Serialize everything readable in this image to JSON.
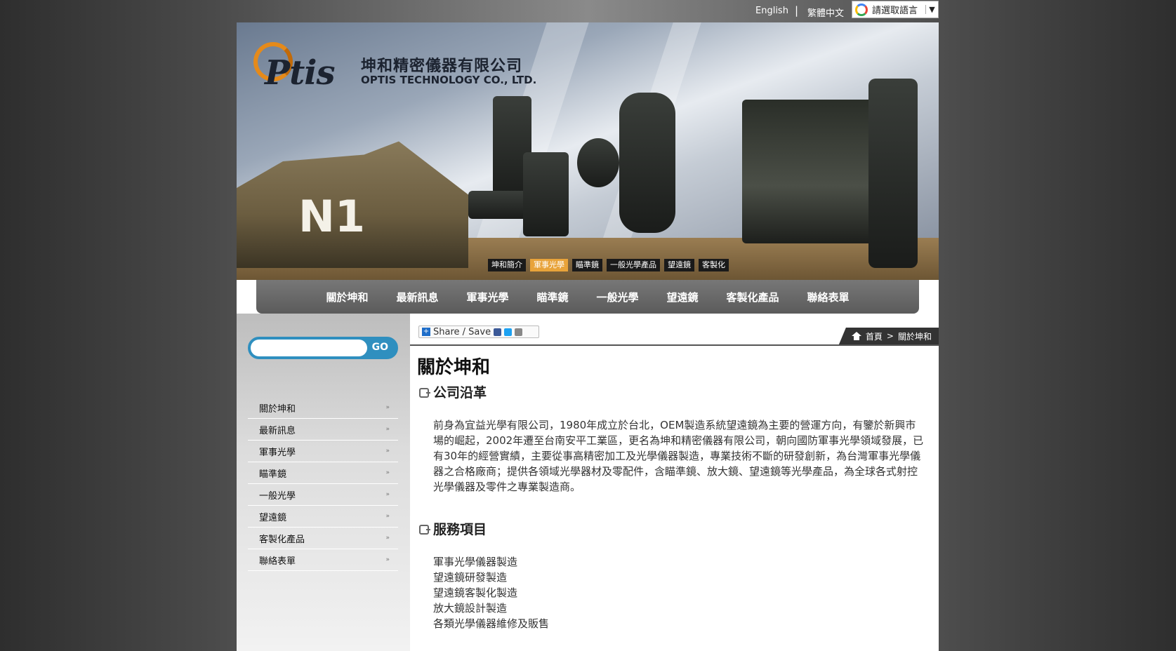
{
  "topbar": {
    "lang_en": "English",
    "separator": "|",
    "lang_zh": "繁體中文",
    "translate_label": "請選取語言",
    "translate_arrow": "▼"
  },
  "banner": {
    "logo_text": "Ptis",
    "company_zh": "坤和精密儀器有限公司",
    "company_en": "OPTIS TECHNOLOGY CO., LTD.",
    "tank_marking": "N1",
    "sub_nav": [
      "坤和簡介",
      "軍事光學",
      "瞄準鏡",
      "一般光學產品",
      "望遠鏡",
      "客製化"
    ],
    "sub_nav_active": "軍事光學"
  },
  "main_nav": [
    "關於坤和",
    "最新訊息",
    "軍事光學",
    "瞄準鏡",
    "一般光學",
    "望遠鏡",
    "客製化產品",
    "聯絡表單"
  ],
  "sidebar": {
    "search_button": "GO",
    "search_value": "",
    "items": [
      "關於坤和",
      "最新訊息",
      "軍事光學",
      "瞄準鏡",
      "一般光學",
      "望遠鏡",
      "客製化產品",
      "聯絡表單"
    ],
    "arrow": "»"
  },
  "content": {
    "share_label": "Share / Save",
    "breadcrumb": {
      "home": "首頁",
      "sep": ">",
      "current": "關於坤和"
    },
    "page_title": "關於坤和",
    "section1_title": "公司沿革",
    "section1_body": "前身為宜益光學有限公司，1980年成立於台北，OEM製造系統望遠鏡為主要的營運方向，有鑒於新興市場的崛起，2002年遷至台南安平工業區，更名為坤和精密儀器有限公司，朝向國防軍事光學領域發展，已有30年的經營實績，主要從事高精密加工及光學儀器製造，專業技術不斷的研發創新，為台灣軍事光學儀器之合格廠商；提供各領域光學器材及零配件，含瞄準鏡、放大鏡、望遠鏡等光學產品，為全球各式射控光學儀器及零件之專業製造商。",
    "section2_title": "服務項目",
    "services": [
      "軍事光學儀器製造",
      "望遠鏡研發製造",
      "望遠鏡客製化製造",
      "放大鏡設計製造",
      "各類光學儀器維修及販售"
    ]
  },
  "colors": {
    "accent_orange": "#e8a33a",
    "nav_gray": "#5b5b5b",
    "search_blue": "#2f8fbf",
    "logo_orange": "#e58a1a"
  }
}
